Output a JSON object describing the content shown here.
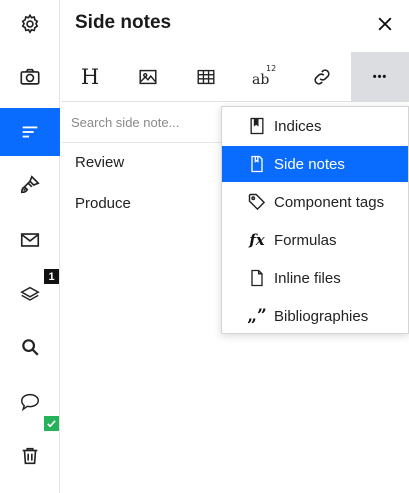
{
  "rail": {
    "items": [
      {
        "name": "settings",
        "icon": "gear-icon"
      },
      {
        "name": "camera",
        "icon": "camera-icon"
      },
      {
        "name": "side-notes",
        "icon": "lines-icon",
        "active": true
      },
      {
        "name": "paint",
        "icon": "paint-brush-icon"
      },
      {
        "name": "mail",
        "icon": "envelope-icon"
      },
      {
        "name": "layers",
        "icon": "layers-icon",
        "badge": "1"
      },
      {
        "name": "search",
        "icon": "magnifier-icon"
      },
      {
        "name": "comments",
        "icon": "speech-bubble-icon"
      },
      {
        "name": "trash",
        "icon": "trash-icon"
      }
    ],
    "accent_color": "#0a6cff"
  },
  "panel": {
    "title": "Side notes"
  },
  "toolbar": {
    "tools": [
      {
        "name": "heading",
        "icon": "heading-icon",
        "glyph": "H"
      },
      {
        "name": "image",
        "icon": "image-icon"
      },
      {
        "name": "table",
        "icon": "table-icon"
      },
      {
        "name": "superscript",
        "icon": "superscript-icon",
        "glyph_base": "ab",
        "glyph_sup": "12"
      },
      {
        "name": "link",
        "icon": "link-icon"
      },
      {
        "name": "more",
        "icon": "more-icon",
        "glyph": "•••",
        "active": true
      }
    ]
  },
  "search": {
    "placeholder": "Search side note..."
  },
  "notes": [
    "Review",
    "Produce"
  ],
  "menu": {
    "items": [
      {
        "label": "Indices",
        "icon": "bookmark-icon"
      },
      {
        "label": "Side notes",
        "icon": "side-note-icon",
        "selected": true
      },
      {
        "label": "Component tags",
        "icon": "tag-icon"
      },
      {
        "label": "Formulas",
        "icon": "function-icon",
        "glyph": "fx"
      },
      {
        "label": "Inline files",
        "icon": "file-icon"
      },
      {
        "label": "Bibliographies",
        "icon": "quote-icon",
        "glyph": "„”"
      }
    ]
  }
}
